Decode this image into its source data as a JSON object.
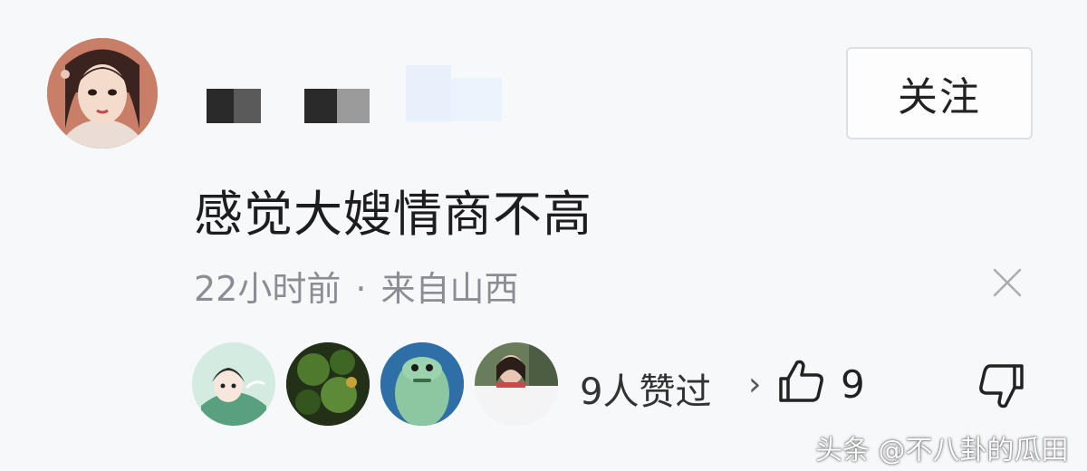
{
  "user": {
    "name": "",
    "follow_label": "关注"
  },
  "comment": {
    "text": "感觉大嫂情商不高",
    "time": "22小时前",
    "separator": "·",
    "location": "来自山西"
  },
  "likes": {
    "summary": "9人赞过",
    "chevron": "›",
    "count": "9"
  },
  "icons": {
    "close": "close-icon",
    "thumb_up": "thumb-up-icon",
    "thumb_down": "thumb-down-icon"
  },
  "watermark": "头条 @不八卦的瓜田"
}
